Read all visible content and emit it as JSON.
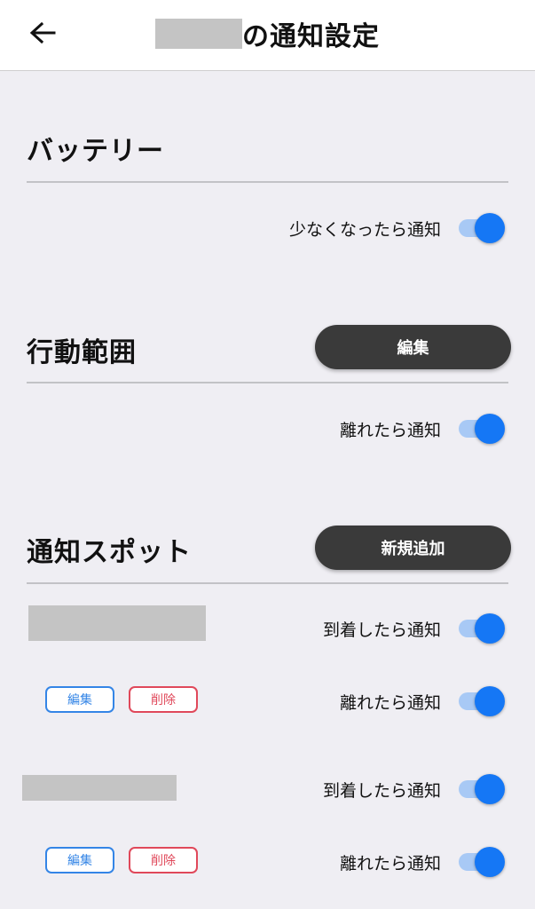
{
  "header": {
    "back_icon": "arrow-left-icon",
    "title": "の通知設定"
  },
  "battery": {
    "title": "バッテリー",
    "low_notify": {
      "label": "少なくなったら通知",
      "on": true
    }
  },
  "range": {
    "title": "行動範囲",
    "edit_label": "編集",
    "leave_notify": {
      "label": "離れたら通知",
      "on": true
    }
  },
  "spots": {
    "title": "通知スポット",
    "add_label": "新規追加",
    "items": [
      {
        "arrive": {
          "label": "到着したら通知",
          "on": true
        },
        "leave": {
          "label": "離れたら通知",
          "on": true
        },
        "edit_label": "編集",
        "delete_label": "削除"
      },
      {
        "arrive": {
          "label": "到着したら通知",
          "on": true
        },
        "leave": {
          "label": "離れたら通知",
          "on": true
        },
        "edit_label": "編集",
        "delete_label": "削除"
      }
    ]
  },
  "colors": {
    "toggle_on": "#1577f5",
    "toggle_track": "#a8c9f5",
    "edit_blue": "#3485e6",
    "delete_red": "#e0485a",
    "dark_button": "#3a3a3a"
  }
}
